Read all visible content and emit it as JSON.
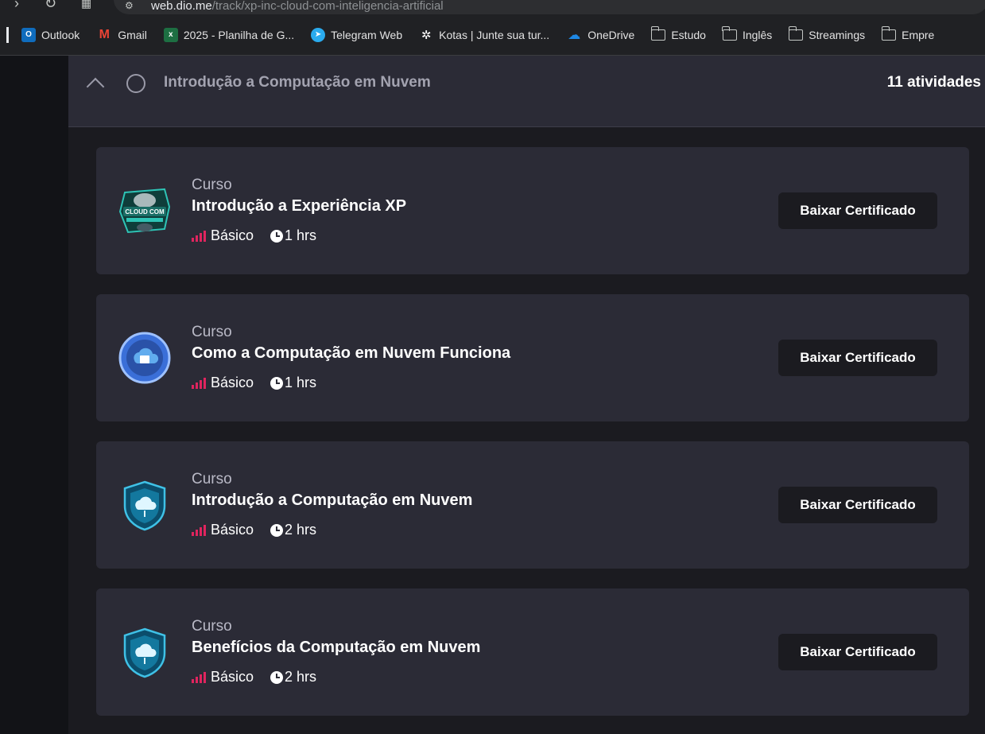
{
  "browser": {
    "url_host": "web.dio.me",
    "url_path": "/track/xp-inc-cloud-com-inteligencia-artificial",
    "bookmarks": [
      {
        "label": "Outlook",
        "icon": "outlook-icon",
        "color": "#0f6cbd"
      },
      {
        "label": "Gmail",
        "icon": "gmail-icon",
        "color": "#ea4335"
      },
      {
        "label": "2025 - Planilha de G...",
        "icon": "excel-icon",
        "color": "#1d6f42"
      },
      {
        "label": "Telegram Web",
        "icon": "telegram-icon",
        "color": "#2aabee"
      },
      {
        "label": "Kotas | Junte sua tur...",
        "icon": "kotas-icon",
        "color": "#ffffff"
      },
      {
        "label": "OneDrive",
        "icon": "onedrive-icon",
        "color": "#1e88e5"
      },
      {
        "label": "Estudo",
        "icon": "folder-icon"
      },
      {
        "label": "Inglês",
        "icon": "folder-icon"
      },
      {
        "label": "Streamings",
        "icon": "folder-icon"
      },
      {
        "label": "Empre",
        "icon": "folder-icon"
      }
    ]
  },
  "section": {
    "title": "Introdução a Computação em Nuvem",
    "count": "11 atividades"
  },
  "cards": [
    {
      "type": "Curso",
      "name": "Introdução a Experiência XP",
      "level": "Básico",
      "duration": "1 hrs",
      "badge": "cloud-ai-badge-icon",
      "badge_text": "CLOUD COM",
      "button": "Baixar Certificado"
    },
    {
      "type": "Curso",
      "name": "Como a Computação em Nuvem Funciona",
      "level": "Básico",
      "duration": "1 hrs",
      "badge": "cloud-circle-badge-icon",
      "button": "Baixar Certificado"
    },
    {
      "type": "Curso",
      "name": "Introdução a Computação em Nuvem",
      "level": "Básico",
      "duration": "2 hrs",
      "badge": "cloud-shield-badge-icon",
      "button": "Baixar Certificado"
    },
    {
      "type": "Curso",
      "name": "Benefícios da Computação em Nuvem",
      "level": "Básico",
      "duration": "2 hrs",
      "badge": "cloud-shield-badge-icon",
      "button": "Baixar Certificado"
    }
  ],
  "colors": {
    "level_icon": "#e0245e",
    "card_bg": "#2b2b36",
    "page_bg": "#1b1b20"
  }
}
